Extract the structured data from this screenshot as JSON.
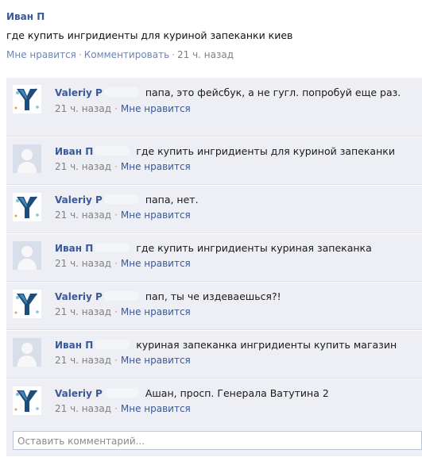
{
  "post": {
    "author": "Иван П",
    "text": "где купить ингридиенты для куриной запеканки киев",
    "like_label": "Мне нравится",
    "comment_label": "Комментировать",
    "time": "21 ч. назад"
  },
  "comments": [
    {
      "author": "Valeriy P",
      "text": "папа, это фейсбук, а не гугл. попробуй еще раз.",
      "time": "21 ч. назад",
      "like_label": "Мне нравится",
      "avatar": "y-logo-icon"
    },
    {
      "author": "Иван П",
      "text": "где купить ингридиенты для куриной запеканки",
      "time": "21 ч. назад",
      "like_label": "Мне нравится",
      "avatar": "default-user-icon"
    },
    {
      "author": "Valeriy P",
      "text": "папа, нет.",
      "time": "21 ч. назад",
      "like_label": "Мне нравится",
      "avatar": "y-logo-icon"
    },
    {
      "author": "Иван П",
      "text": "где купить ингридиенты куриная запеканка",
      "time": "21 ч. назад",
      "like_label": "Мне нравится",
      "avatar": "default-user-icon"
    },
    {
      "author": "Valeriy P",
      "text": "пап, ты че издеваешься?!",
      "time": "21 ч. назад",
      "like_label": "Мне нравится",
      "avatar": "y-logo-icon"
    },
    {
      "author": "Иван П",
      "text": "куриная запеканка ингридиенты купить магазин",
      "time": "21 ч. назад",
      "like_label": "Мне нравится",
      "avatar": "default-user-icon"
    },
    {
      "author": "Valeriy P",
      "text": "Ашан,  просп. Генерала Ватутина 2",
      "time": "21 ч. назад",
      "like_label": "Мне нравится",
      "avatar": "y-logo-icon"
    }
  ],
  "comment_input": {
    "placeholder": "Оставить комментарий..."
  }
}
